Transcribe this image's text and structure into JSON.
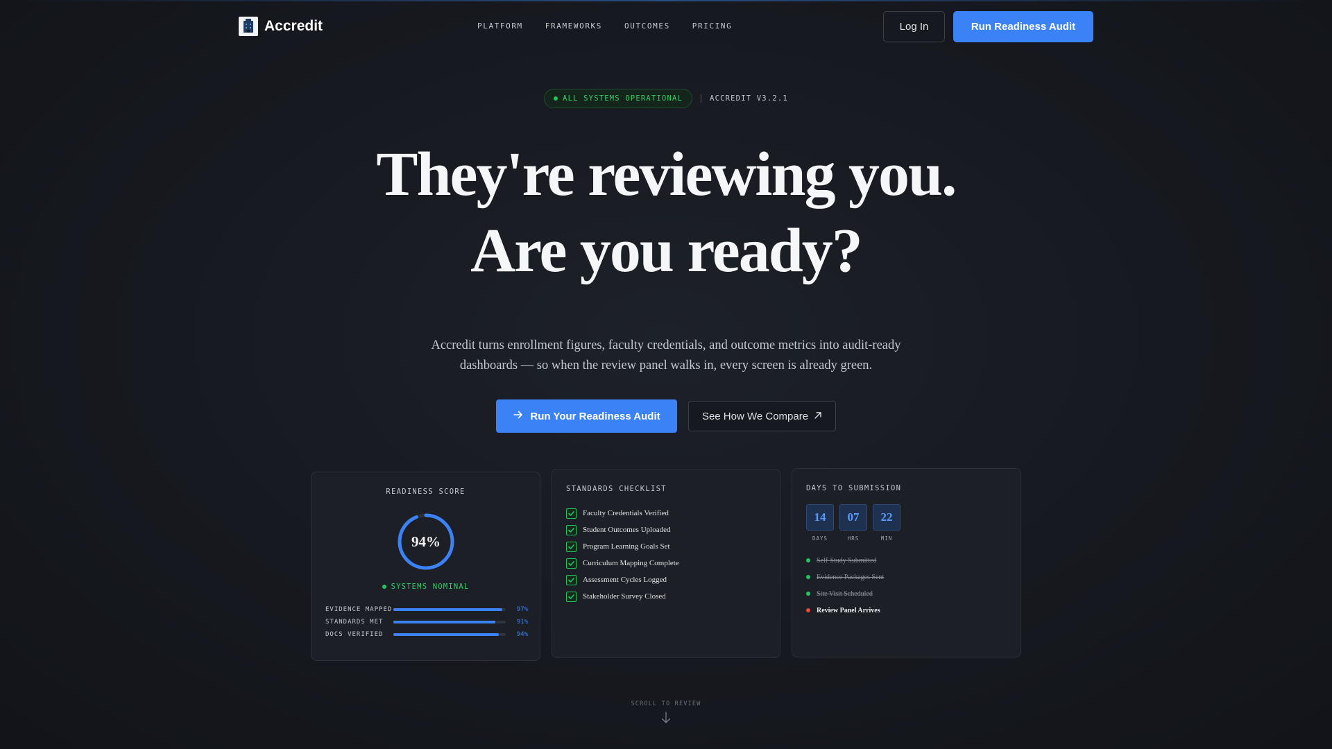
{
  "brand": {
    "name": "Accredit"
  },
  "nav": {
    "links": [
      "PLATFORM",
      "FRAMEWORKS",
      "OUTCOMES",
      "PRICING"
    ],
    "login_label": "Log In",
    "cta_label": "Run Readiness Audit"
  },
  "status": {
    "pill": "ALL SYSTEMS OPERATIONAL",
    "version": "ACCREDIT V3.2.1",
    "color": "#22c55e"
  },
  "hero": {
    "headline_line1": "They're reviewing you.",
    "headline_line2": "Are you ready?",
    "subtext": "Accredit turns enrollment figures, faculty credentials, and outcome metrics into audit-ready dashboards — so when the review panel walks in, every screen is already green.",
    "primary_cta": "Run Your Readiness Audit",
    "secondary_cta": "See How We Compare"
  },
  "readiness": {
    "title": "READINESS SCORE",
    "score_label": "94%",
    "score": 0.94,
    "status": "SYSTEMS NOMINAL",
    "metrics": [
      {
        "label": "EVIDENCE MAPPED",
        "value": "97%",
        "fraction": 0.97
      },
      {
        "label": "STANDARDS MET",
        "value": "91%",
        "fraction": 0.91
      },
      {
        "label": "DOCS VERIFIED",
        "value": "94%",
        "fraction": 0.94
      }
    ]
  },
  "checklist": {
    "title": "STANDARDS CHECKLIST",
    "items": [
      "Faculty Credentials Verified",
      "Student Outcomes Uploaded",
      "Program Learning Goals Set",
      "Curriculum Mapping Complete",
      "Assessment Cycles Logged",
      "Stakeholder Survey Closed"
    ]
  },
  "submission": {
    "title": "DAYS TO SUBMISSION",
    "countdown": [
      {
        "value": "14",
        "label": "DAYS"
      },
      {
        "value": "07",
        "label": "HRS"
      },
      {
        "value": "22",
        "label": "MIN"
      }
    ],
    "milestones": [
      {
        "label": "Self-Study Submitted",
        "state": "done"
      },
      {
        "label": "Evidence Packages Sent",
        "state": "done"
      },
      {
        "label": "Site Visit Scheduled",
        "state": "done"
      },
      {
        "label": "Review Panel Arrives",
        "state": "pending"
      }
    ]
  },
  "scroll_hint": "SCROLL TO REVIEW",
  "colors": {
    "accent": "#3b82f6",
    "success": "#22c55e",
    "alert": "#ef4444"
  }
}
